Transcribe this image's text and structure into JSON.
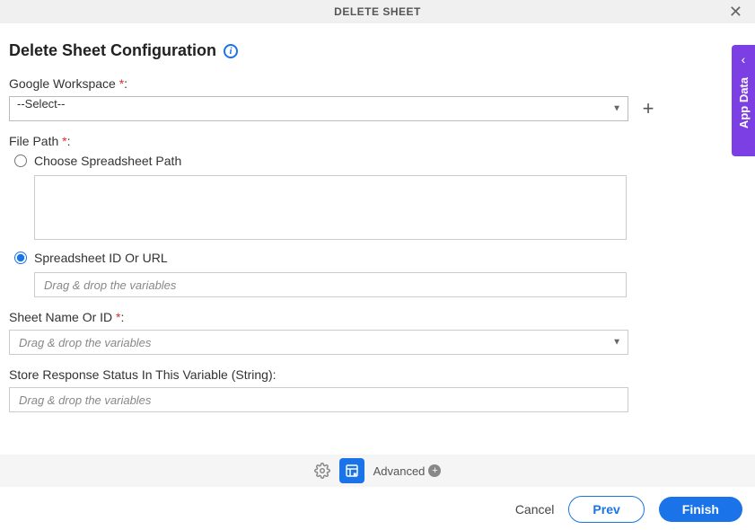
{
  "header": {
    "title": "DELETE SHEET"
  },
  "page": {
    "title": "Delete Sheet Configuration"
  },
  "fields": {
    "workspace": {
      "label": "Google Workspace ",
      "req": "*",
      "colon": ":",
      "value": "--Select--"
    },
    "filepath": {
      "label": "File Path ",
      "req": "*",
      "colon": ":"
    },
    "radio1": {
      "label": "Choose Spreadsheet Path"
    },
    "radio2": {
      "label": "Spreadsheet ID Or URL"
    },
    "url_input": {
      "placeholder": "Drag & drop the variables"
    },
    "sheetname": {
      "label": "Sheet Name Or ID ",
      "req": "*",
      "colon": ":",
      "placeholder": "Drag & drop the variables"
    },
    "response": {
      "label": "Store Response Status In This Variable (String):",
      "placeholder": "Drag & drop the variables"
    }
  },
  "sidebar": {
    "label": "App Data"
  },
  "bottom": {
    "advanced": "Advanced"
  },
  "footer": {
    "cancel": "Cancel",
    "prev": "Prev",
    "finish": "Finish"
  }
}
